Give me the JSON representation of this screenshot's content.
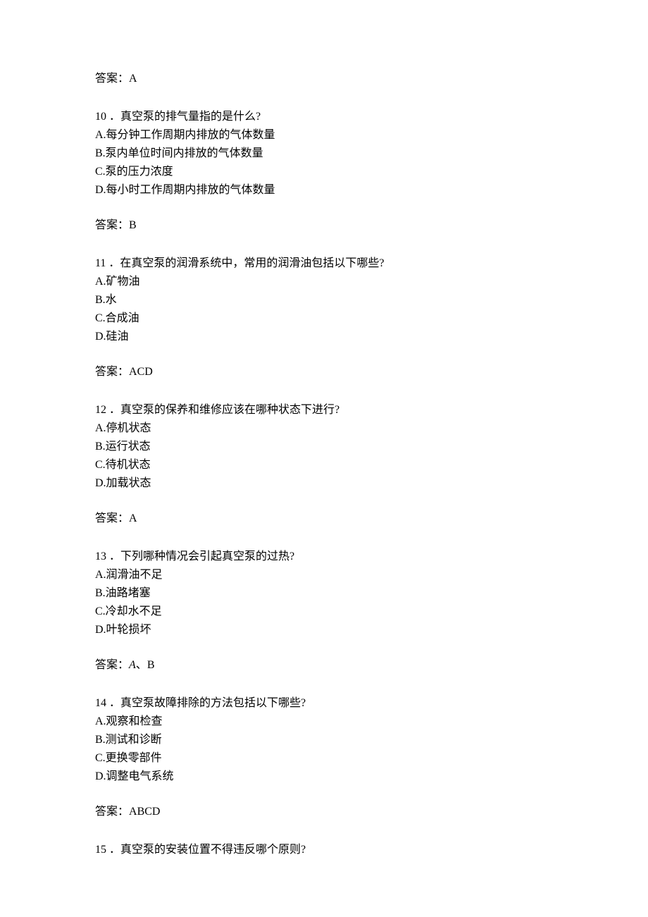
{
  "answer_label": "答案：",
  "q9": {
    "answer": "A"
  },
  "q10": {
    "number": "10",
    "question": "．真空泵的排气量指的是什么?",
    "options": {
      "A": "A.每分钟工作周期内排放的气体数量",
      "B": "B.泵内单位时间内排放的气体数量",
      "C": "C.泵的压力浓度",
      "D": "D.每小时工作周期内排放的气体数量"
    },
    "answer": "B"
  },
  "q11": {
    "number": "11",
    "question": "．在真空泵的润滑系统中，常用的润滑油包括以下哪些?",
    "options": {
      "A": "A.矿物油",
      "B": "B.水",
      "C": "C.合成油",
      "D": "D.硅油"
    },
    "answer": "ACD"
  },
  "q12": {
    "number": "12",
    "question": "．真空泵的保养和维修应该在哪种状态下进行?",
    "options": {
      "A": "A.停机状态",
      "B": "B.运行状态",
      "C": "C.待机状态",
      "D": "D.加载状态"
    },
    "answer": "A"
  },
  "q13": {
    "number": "13",
    "question": "．下列哪种情况会引起真空泵的过热?",
    "options": {
      "A": "A.润滑油不足",
      "B": "B.油路堵塞",
      "C": "C.冷却水不足",
      "D": "D.叶轮损坏"
    },
    "answer_part1": "A",
    "answer_sep": "、",
    "answer_part2": "B"
  },
  "q14": {
    "number": "14",
    "question": "．真空泵故障排除的方法包括以下哪些?",
    "options": {
      "A": "A.观察和检查",
      "B": "B.测试和诊断",
      "C": "C.更换零部件",
      "D": "D.调整电气系统"
    },
    "answer": "ABCD"
  },
  "q15": {
    "number": "15",
    "question": "．真空泵的安装位置不得违反哪个原则?"
  }
}
